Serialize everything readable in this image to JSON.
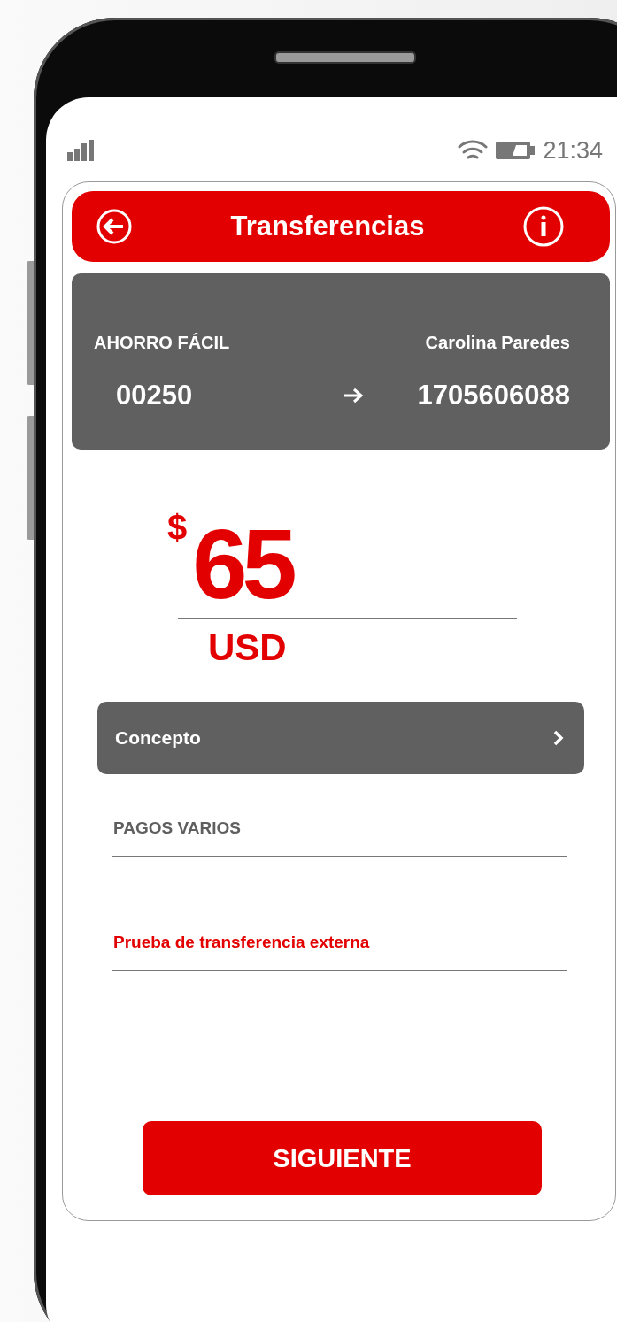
{
  "status_bar": {
    "time": "21:34"
  },
  "header": {
    "title": "Transferencias"
  },
  "account": {
    "type": "AHORRO FÁCIL",
    "holder": "Carolina Paredes",
    "from": "00250",
    "to": "1705606088"
  },
  "amount": {
    "symbol": "$",
    "value": "65",
    "currency": "USD"
  },
  "concept": {
    "label": "Concepto"
  },
  "fields": [
    {
      "value": "PAGOS VARIOS",
      "color": "#5f5f5f"
    },
    {
      "value": "Prueba de transferencia externa",
      "color": "#e30000"
    }
  ],
  "button": {
    "label": "SIGUIENTE"
  }
}
